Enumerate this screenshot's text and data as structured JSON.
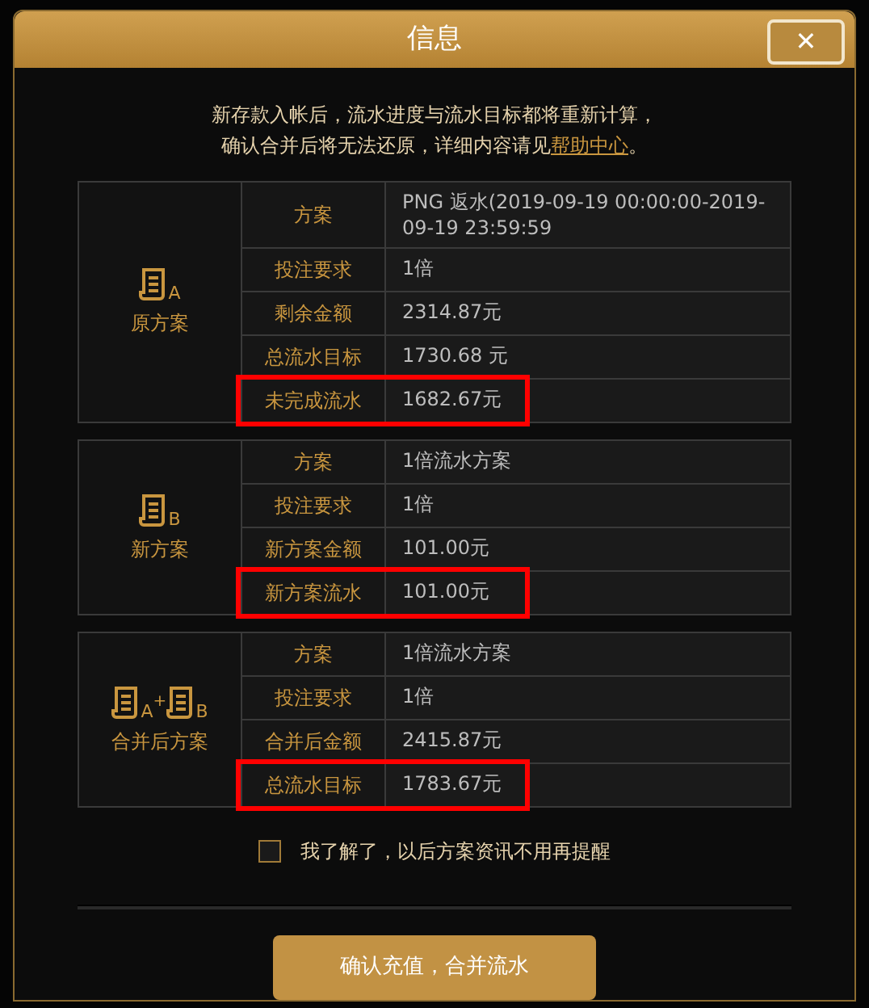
{
  "dialog": {
    "title": "信息",
    "close": "✕"
  },
  "notice": {
    "line1": "新存款入帐后，流水进度与流水目标都将重新计算，",
    "line2": "确认合并后将无法还原，详细内容请见",
    "link": "帮助中心",
    "end": "。"
  },
  "plans": [
    {
      "icons": [
        {
          "letter": "A"
        }
      ],
      "title": "原方案",
      "rows": [
        {
          "label": "方案",
          "value": "PNG 返水(2019-09-19 00:00:00-2019-09-19 23:59:59",
          "highlighted": false
        },
        {
          "label": "投注要求",
          "value": "1倍",
          "highlighted": false
        },
        {
          "label": "剩余金额",
          "value": "2314.87元",
          "highlighted": false
        },
        {
          "label": "总流水目标",
          "value": "1730.68 元",
          "highlighted": false
        },
        {
          "label": "未完成流水",
          "value": "1682.67元",
          "highlighted": true
        }
      ]
    },
    {
      "icons": [
        {
          "letter": "B"
        }
      ],
      "title": "新方案",
      "rows": [
        {
          "label": "方案",
          "value": "1倍流水方案",
          "highlighted": false
        },
        {
          "label": "投注要求",
          "value": "1倍",
          "highlighted": false
        },
        {
          "label": "新方案金额",
          "value": "101.00元",
          "highlighted": false
        },
        {
          "label": "新方案流水",
          "value": "101.00元",
          "highlighted": true
        }
      ]
    },
    {
      "icons": [
        {
          "letter": "A"
        },
        {
          "letter": "B"
        }
      ],
      "joiner": "+",
      "title": "合并后方案",
      "rows": [
        {
          "label": "方案",
          "value": "1倍流水方案",
          "highlighted": false
        },
        {
          "label": "投注要求",
          "value": "1倍",
          "highlighted": false
        },
        {
          "label": "合并后金额",
          "value": "2415.87元",
          "highlighted": false
        },
        {
          "label": "总流水目标",
          "value": "1783.67元",
          "highlighted": true
        }
      ]
    }
  ],
  "reminder": {
    "label": "我了解了，以后方案资讯不用再提醒",
    "checked": false
  },
  "confirm_button": "确认充值，合并流水"
}
